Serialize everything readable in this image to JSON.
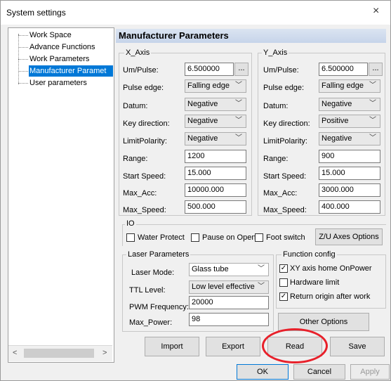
{
  "window": {
    "title": "System settings",
    "close_glyph": "×"
  },
  "tree": {
    "items": [
      {
        "label": "Work Space"
      },
      {
        "label": "Advance Functions"
      },
      {
        "label": "Work Parameters"
      },
      {
        "label": "Manufacturer Paramet",
        "selected": true
      },
      {
        "label": "User parameters"
      }
    ],
    "scroll_left": "<",
    "scroll_right": ">"
  },
  "panel": {
    "title": "Manufacturer Parameters"
  },
  "x_axis": {
    "group_label": "X_Axis",
    "um_pulse_label": "Um/Pulse:",
    "um_pulse": "6.500000",
    "pulse_edge_label": "Pulse edge:",
    "pulse_edge": "Falling edge",
    "datum_label": "Datum:",
    "datum": "Negative",
    "key_direction_label": "Key direction:",
    "key_direction": "Negative",
    "limit_polarity_label": "LimitPolarity:",
    "limit_polarity": "Negative",
    "range_label": "Range:",
    "range": "1200",
    "start_speed_label": "Start Speed:",
    "start_speed": "15.000",
    "max_acc_label": "Max_Acc:",
    "max_acc": "10000.000",
    "max_speed_label": "Max_Speed:",
    "max_speed": "500.000"
  },
  "y_axis": {
    "group_label": "Y_Axis",
    "um_pulse_label": "Um/Pulse:",
    "um_pulse": "6.500000",
    "pulse_edge_label": "Pulse edge:",
    "pulse_edge": "Falling edge",
    "datum_label": "Datum:",
    "datum": "Negative",
    "key_direction_label": "Key direction:",
    "key_direction": "Positive",
    "limit_polarity_label": "LimitPolarity:",
    "limit_polarity": "Negative",
    "range_label": "Range:",
    "range": "900",
    "start_speed_label": "Start Speed:",
    "start_speed": "15.000",
    "max_acc_label": "Max_Acc:",
    "max_acc": "3000.000",
    "max_speed_label": "Max_Speed:",
    "max_speed": "400.000"
  },
  "dots_label": "...",
  "io": {
    "group_label": "IO",
    "water_protect": {
      "label": "Water Protect",
      "checked": false
    },
    "pause_on_open": {
      "label": "Pause on Open",
      "checked": false
    },
    "foot_switch": {
      "label": "Foot switch",
      "checked": false
    },
    "zu_axes_button": "Z/U Axes Options"
  },
  "laser": {
    "group_label": "Laser Parameters",
    "mode_label": "Laser Mode:",
    "mode": "Glass tube",
    "ttl_label": "TTL Level:",
    "ttl": "Low level effective",
    "pwm_label": "PWM Frequency:",
    "pwm": "20000",
    "max_power_label": "Max_Power:",
    "max_power": "98"
  },
  "function_config": {
    "group_label": "Function config",
    "xy_home": {
      "label": "XY axis home OnPower",
      "checked": true
    },
    "hardware_limit": {
      "label": "Hardware limit",
      "checked": false
    },
    "return_origin": {
      "label": "Return origin after work",
      "checked": true
    },
    "other_options_button": "Other Options"
  },
  "actions": {
    "import": "Import",
    "export": "Export",
    "read": "Read",
    "save": "Save"
  },
  "dialog": {
    "ok": "OK",
    "cancel": "Cancel",
    "apply": "Apply"
  },
  "chevron_glyph": "﹀",
  "check_glyph": "✓",
  "colors": {
    "selection": "#0078d7",
    "highlight_circle": "#e8202a"
  }
}
